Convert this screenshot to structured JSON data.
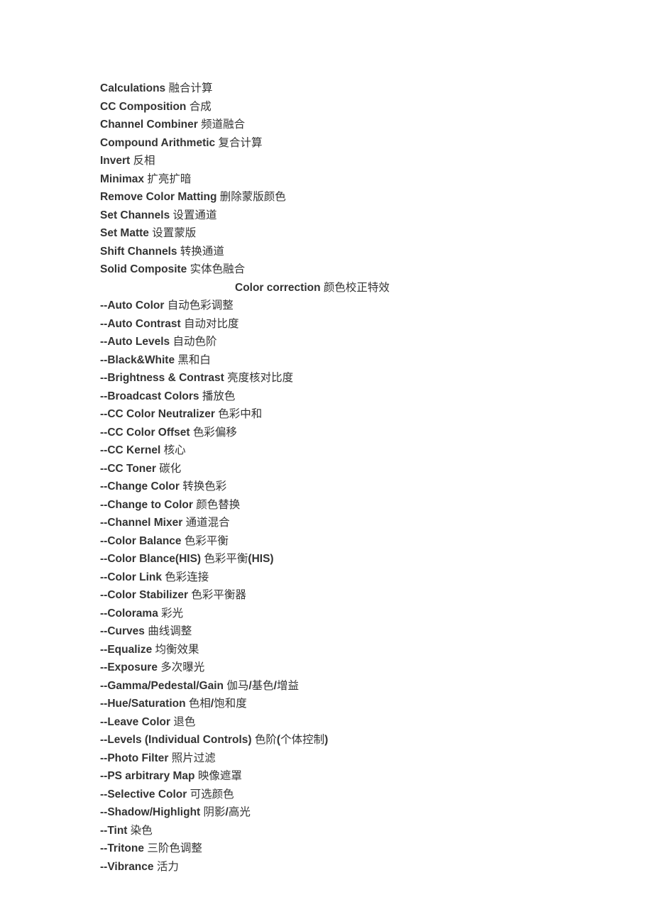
{
  "group1": [
    {
      "en": "Calculations",
      "zh": "融合计算"
    },
    {
      "en": "CC Composition",
      "zh": "合成"
    },
    {
      "en": "Channel Combiner",
      "zh": "频道融合"
    },
    {
      "en": "Compound Arithmetic",
      "zh": "复合计算"
    },
    {
      "en": "Invert",
      "zh": "反相"
    },
    {
      "en": "Minimax",
      "zh": "扩亮扩暗"
    },
    {
      "en": "Remove Color Matting",
      "zh": "删除蒙版颜色"
    },
    {
      "en": "Set Channels",
      "zh": "设置通道"
    },
    {
      "en": "Set Matte",
      "zh": "设置蒙版"
    },
    {
      "en": "Shift Channels",
      "zh": "转换通道"
    },
    {
      "en": "Solid Composite",
      "zh": "实体色融合"
    }
  ],
  "section": {
    "en": "Color correction",
    "zh": "颜色校正特效"
  },
  "group2": [
    {
      "prefix": "--",
      "en": "Auto Color",
      "zh": "自动色彩调整"
    },
    {
      "prefix": "--",
      "en": "Auto Contrast",
      "zh": "自动对比度"
    },
    {
      "prefix": "--",
      "en": "Auto Levels",
      "zh": "自动色阶"
    },
    {
      "prefix": "--",
      "en": "Black&White",
      "zh": "黑和白"
    },
    {
      "prefix": "--",
      "en": "Brightness & Contrast",
      "zh": "亮度核对比度"
    },
    {
      "prefix": "--",
      "en": "Broadcast Colors",
      "zh": "播放色"
    },
    {
      "prefix": "--",
      "en": "CC Color Neutralizer",
      "zh": "色彩中和"
    },
    {
      "prefix": "--",
      "en": "CC Color Offset",
      "zh": "色彩偏移"
    },
    {
      "prefix": "--",
      "en": "CC Kernel",
      "zh": "核心"
    },
    {
      "prefix": "--",
      "en": "CC Toner",
      "zh": "碳化"
    },
    {
      "prefix": "--",
      "en": "Change Color",
      "zh": "转换色彩"
    },
    {
      "prefix": "--",
      "en": "Change to Color",
      "zh": "颜色替换"
    },
    {
      "prefix": "--",
      "en": "Channel Mixer",
      "zh": "通道混合"
    },
    {
      "prefix": "--",
      "en": "Color Balance",
      "zh": "色彩平衡"
    },
    {
      "prefix": "--",
      "en": "Color Blance(HIS)",
      "zh_bold_open": "色彩平衡",
      "zh_bold_mid": "(HIS)",
      "zh": ""
    },
    {
      "prefix": "--",
      "en": "Color Link",
      "zh": "色彩连接"
    },
    {
      "prefix": "--",
      "en": "Color Stabilizer",
      "zh": "色彩平衡器"
    },
    {
      "prefix": "--",
      "en": "Colorama",
      "zh": "彩光"
    },
    {
      "prefix": "--",
      "en": "Curves",
      "zh": "曲线调整"
    },
    {
      "prefix": "--",
      "en": "Equalize",
      "zh": "均衡效果"
    },
    {
      "prefix": "--",
      "en": "Exposure",
      "zh": "多次曝光"
    },
    {
      "prefix": "--",
      "en": "Gamma/Pedestal/Gain",
      "zh_parts": [
        "伽马",
        "/",
        "基色",
        "/",
        "增益"
      ]
    },
    {
      "prefix": "--",
      "en": "Hue/Saturation",
      "zh_parts": [
        "色相",
        "/",
        "饱和度"
      ]
    },
    {
      "prefix": "--",
      "en": "Leave Color",
      "zh": "退色"
    },
    {
      "prefix": "--",
      "en": "Levels (Individual Controls)",
      "zh_parts": [
        "色阶",
        "(",
        "个体控制",
        ")"
      ]
    },
    {
      "prefix": "--",
      "en": "Photo Filter",
      "zh": "照片过滤"
    },
    {
      "prefix": "--",
      "en": "PS arbitrary Map",
      "zh": "映像遮罩"
    },
    {
      "prefix": "--",
      "en": "Selective Color",
      "zh": "可选颜色"
    },
    {
      "prefix": "--",
      "en": "Shadow/Highlight",
      "zh_parts": [
        "阴影",
        "/",
        "高光"
      ]
    },
    {
      "prefix": "--",
      "en": "Tint",
      "zh": "染色"
    },
    {
      "prefix": "--",
      "en": "Tritone",
      "zh": "三阶色调整"
    },
    {
      "prefix": "--",
      "en": "Vibrance",
      "zh": "活力"
    }
  ]
}
